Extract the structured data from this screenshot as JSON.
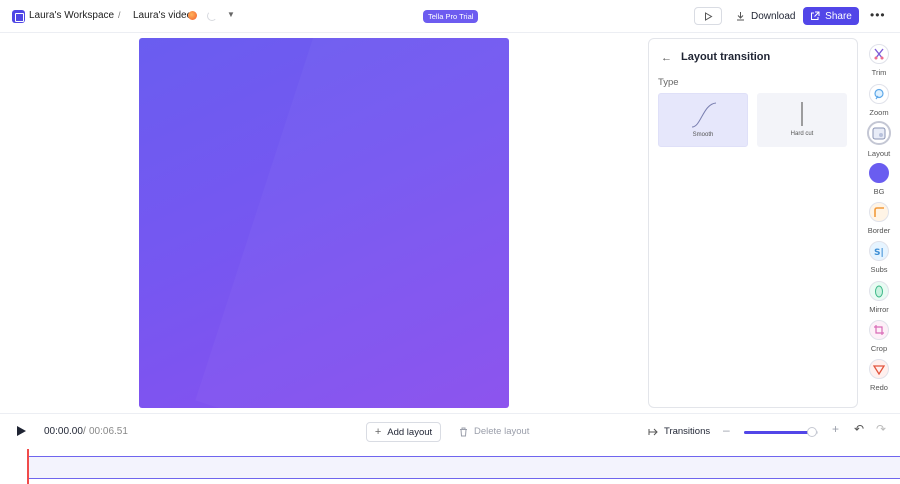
{
  "header": {
    "workspace_name": "Laura's Workspace",
    "crumb_separator": "/",
    "video_name": "Laura's video",
    "pro_badge": "Tella Pro Trial",
    "download_label": "Download",
    "share_label": "Share",
    "more_label": "•••"
  },
  "panel": {
    "title": "Layout transition",
    "type_label": "Type",
    "options": [
      {
        "label": "Smooth",
        "selected": true
      },
      {
        "label": "Hard cut",
        "selected": false
      }
    ]
  },
  "tools": [
    {
      "label": "Trim",
      "icon": "trim-icon"
    },
    {
      "label": "Zoom",
      "icon": "zoom-icon"
    },
    {
      "label": "Layout",
      "icon": "layout-icon",
      "active": true
    },
    {
      "label": "BG",
      "icon": "background-color-icon"
    },
    {
      "label": "Border",
      "icon": "border-icon"
    },
    {
      "label": "Subs",
      "icon": "subtitles-icon"
    },
    {
      "label": "Mirror",
      "icon": "mirror-icon"
    },
    {
      "label": "Crop",
      "icon": "crop-icon"
    },
    {
      "label": "Redo",
      "icon": "redo-icon"
    }
  ],
  "playback": {
    "current_time": "00:00.00",
    "separator": "/",
    "total_time": "00:06.51"
  },
  "actions": {
    "add_layout": "Add layout",
    "delete_layout": "Delete layout",
    "transitions": "Transitions"
  },
  "zoom": {
    "level": 0.92
  },
  "colors": {
    "accent": "#5246e8",
    "canvas_start": "#6a5df0",
    "canvas_end": "#8a4fee",
    "playhead": "#f04b4b"
  }
}
